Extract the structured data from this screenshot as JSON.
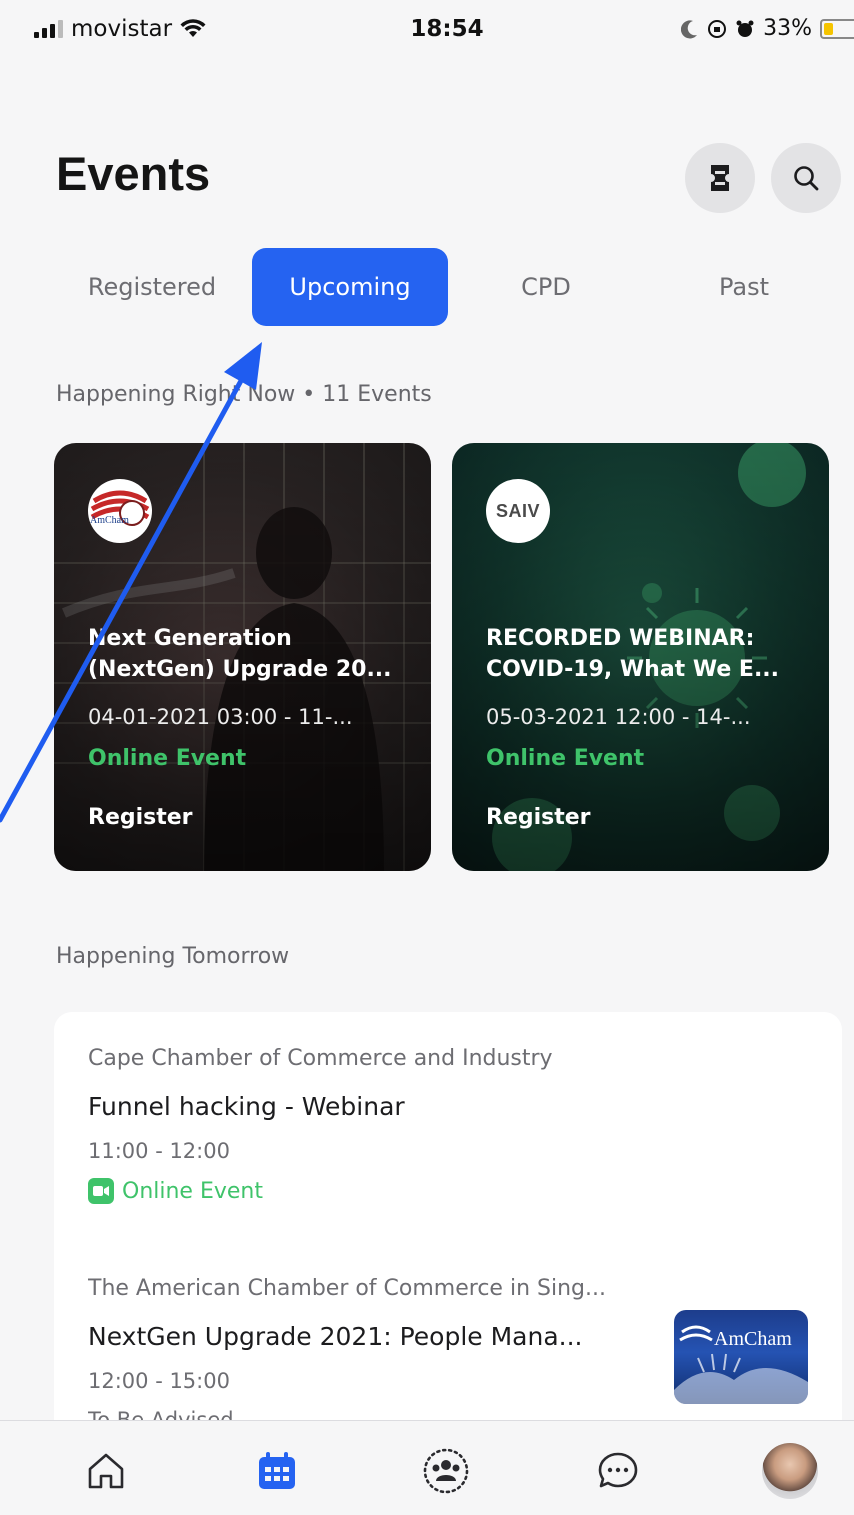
{
  "status_bar": {
    "carrier": "movistar",
    "time": "18:54",
    "battery": "33%",
    "battery_level": 0.33
  },
  "header": {
    "title": "Events",
    "ticket_icon": "ticket-icon",
    "search_icon": "search-icon"
  },
  "tabs": [
    {
      "label": "Registered",
      "active": false
    },
    {
      "label": "Upcoming",
      "active": true
    },
    {
      "label": "CPD",
      "active": false
    },
    {
      "label": "Past",
      "active": false
    }
  ],
  "now_section": {
    "label": "Happening Right Now • 11 Events",
    "events": [
      {
        "logo": "AmCham",
        "title_line1": "Next Generation",
        "title_line2": "(NextGen) Upgrade 20...",
        "date": "04-01-2021  03:00 - 11-...",
        "type": "Online Event",
        "action": "Register"
      },
      {
        "logo": "SAIV",
        "title_line1": "RECORDED WEBINAR:",
        "title_line2": "COVID-19, What We E...",
        "date": "05-03-2021  12:00 - 14-...",
        "type": "Online Event",
        "action": "Register"
      }
    ]
  },
  "tomorrow_section": {
    "label": "Happening Tomorrow",
    "items": [
      {
        "org": "Cape Chamber of Commerce and Industry",
        "title": "Funnel hacking - Webinar",
        "time": "11:00 - 12:00",
        "type": "Online Event"
      },
      {
        "org": "The American Chamber of Commerce in Sing...",
        "title": "NextGen Upgrade 2021: People Mana...",
        "time": "12:00 - 15:00",
        "type": "To Be Advised",
        "thumb_text": "AmCham"
      }
    ]
  },
  "bottom_nav": [
    {
      "icon": "home-icon"
    },
    {
      "icon": "calendar-icon",
      "active": true
    },
    {
      "icon": "community-icon"
    },
    {
      "icon": "chat-icon"
    },
    {
      "icon": "avatar"
    }
  ],
  "colors": {
    "accent": "#2563f1",
    "online": "#3fc36a",
    "background": "#f6f6f7"
  }
}
